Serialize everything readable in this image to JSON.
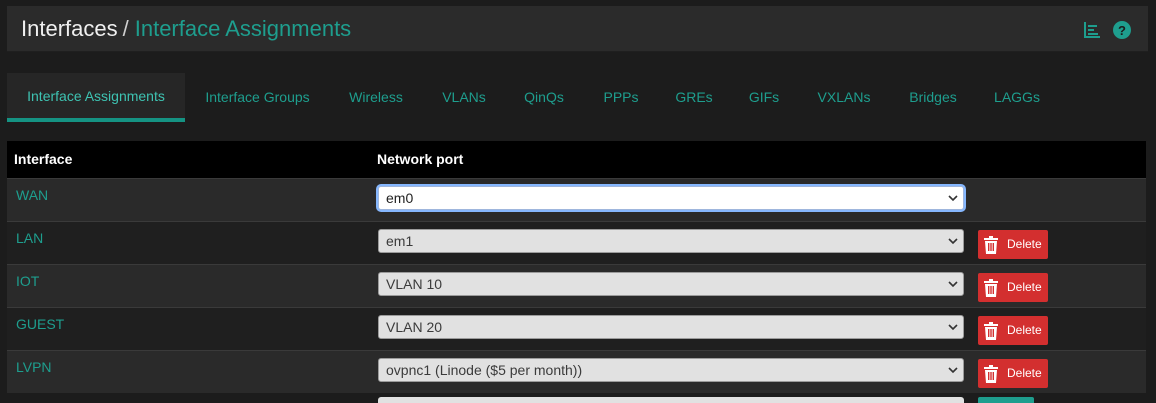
{
  "header": {
    "breadcrumb_root": "Interfaces",
    "breadcrumb_sep": "/",
    "breadcrumb_current": "Interface Assignments",
    "icons": [
      "bar-chart-icon",
      "help-icon"
    ]
  },
  "tabs": [
    {
      "label": "Interface Assignments",
      "active": true
    },
    {
      "label": "Interface Groups",
      "active": false
    },
    {
      "label": "Wireless",
      "active": false
    },
    {
      "label": "VLANs",
      "active": false
    },
    {
      "label": "QinQs",
      "active": false
    },
    {
      "label": "PPPs",
      "active": false
    },
    {
      "label": "GREs",
      "active": false
    },
    {
      "label": "GIFs",
      "active": false
    },
    {
      "label": "VXLANs",
      "active": false
    },
    {
      "label": "Bridges",
      "active": false
    },
    {
      "label": "LAGGs",
      "active": false
    }
  ],
  "table": {
    "col_interface": "Interface",
    "col_network_port": "Network port",
    "rows": [
      {
        "interface": "WAN",
        "port": "em0",
        "delete": ""
      },
      {
        "interface": "LAN",
        "port": "em1",
        "delete": "Delete"
      },
      {
        "interface": "IOT",
        "port": "VLAN 10",
        "delete": "Delete"
      },
      {
        "interface": "GUEST",
        "port": "VLAN 20",
        "delete": "Delete"
      },
      {
        "interface": "LVPN",
        "port": "ovpnc1 (Linode ($5 per month))",
        "delete": "Delete"
      }
    ]
  },
  "colors": {
    "accent": "#1e9e8e",
    "delete": "#d32f2f",
    "header_bg": "#2b2b2b",
    "table_head_bg": "#000000"
  }
}
